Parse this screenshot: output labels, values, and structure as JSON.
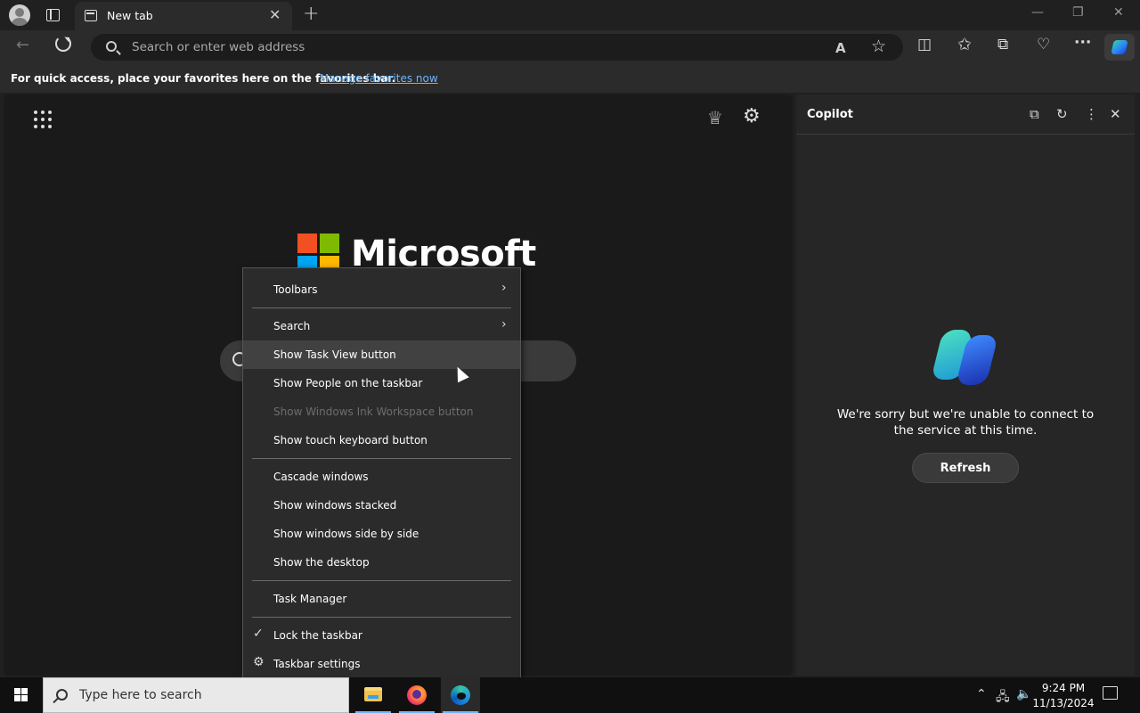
{
  "browser": {
    "tab": {
      "title": "New tab",
      "close_glyph": "✕"
    },
    "new_tab_glyph": "+",
    "window_controls": {
      "minimize": "—",
      "restore": "❐",
      "close": "✕"
    },
    "address_bar": {
      "placeholder": "Search or enter web address"
    },
    "toolbar_icons": {
      "read_aloud": "A",
      "favorite_star": "☆",
      "split_screen": "◫",
      "favorites": "✩",
      "collections": "⧉",
      "performance": "♡",
      "more": "···"
    },
    "favorites_bar": {
      "message": "For quick access, place your favorites here on the favorites bar.",
      "link": "Manage favorites now"
    }
  },
  "new_tab_page": {
    "brand": "Microsoft",
    "logo_colors": [
      "#f25022",
      "#7fba00",
      "#00a4ef",
      "#ffb900"
    ],
    "icons": {
      "rewards": "♕",
      "settings": "⚙"
    }
  },
  "copilot": {
    "title": "Copilot",
    "message": "We're sorry but we're unable to connect to the service at this time.",
    "refresh_label": "Refresh",
    "icons": {
      "open": "⧉",
      "reload": "↻",
      "more": "⋮",
      "close": "✕"
    }
  },
  "context_menu": {
    "items": [
      {
        "label": "Toolbars",
        "submenu": true
      },
      {
        "label": "Search",
        "submenu": true
      },
      {
        "label": "Show Task View button",
        "hover": true
      },
      {
        "label": "Show People on the taskbar"
      },
      {
        "label": "Show Windows Ink Workspace button",
        "disabled": true
      },
      {
        "label": "Show touch keyboard button"
      },
      {
        "label": "Cascade windows"
      },
      {
        "label": "Show windows stacked"
      },
      {
        "label": "Show windows side by side"
      },
      {
        "label": "Show the desktop"
      },
      {
        "label": "Task Manager"
      },
      {
        "label": "Lock the taskbar",
        "checked": true
      },
      {
        "label": "Taskbar settings",
        "icon": "gear"
      }
    ],
    "arrow_glyph": "›",
    "check_glyph": "✓",
    "gear_glyph": "⚙"
  },
  "taskbar": {
    "search_placeholder": "Type here to search",
    "apps": [
      "file-explorer",
      "firefox",
      "edge"
    ],
    "tray": {
      "chevron": "⌃",
      "network": "🖧",
      "volume": "🔈"
    },
    "clock": {
      "time": "9:24 PM",
      "date": "11/13/2024"
    },
    "accent_color": "#6cb6ff"
  }
}
